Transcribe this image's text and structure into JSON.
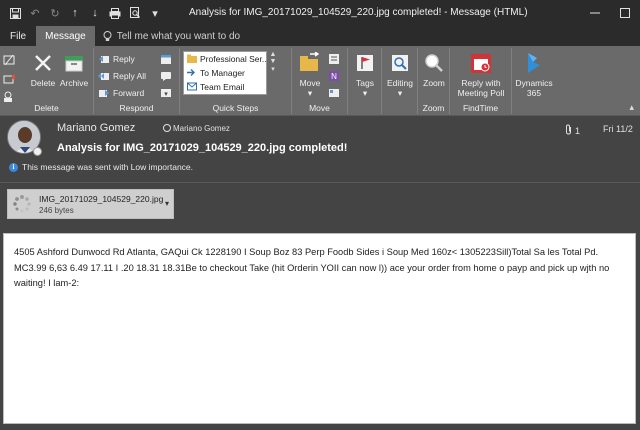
{
  "window": {
    "title": "Analysis for IMG_20171029_104529_220.jpg completed!  -  Message (HTML)"
  },
  "tabs": [
    {
      "label": "File"
    },
    {
      "label": "Message"
    }
  ],
  "tell_me": {
    "placeholder": "Tell me what you want to do"
  },
  "ribbon": {
    "delete_group": {
      "label": "Delete",
      "delete": "Delete",
      "archive": "Archive"
    },
    "respond_group": {
      "label": "Respond",
      "reply": "Reply",
      "reply_all": "Reply All",
      "forward": "Forward"
    },
    "quick_steps": {
      "label": "Quick Steps",
      "items": [
        "Professional Ser...",
        "To Manager",
        "Team Email"
      ]
    },
    "move_group": {
      "label": "Move",
      "move": "Move"
    },
    "tags": {
      "label": "Tags"
    },
    "editing": {
      "label": "Editing"
    },
    "zoom_group": {
      "label": "Zoom",
      "zoom": "Zoom"
    },
    "findtime": {
      "label": "FindTime",
      "button": "Reply with Meeting Poll"
    },
    "dynamics": {
      "label": "Dynamics 365"
    }
  },
  "message": {
    "sender": "Mariano Gomez",
    "sender_small": "Mariano Gomez",
    "subject": "Analysis for IMG_20171029_104529_220.jpg completed!",
    "attachment_count": "1",
    "date": "Fri 11/2",
    "importance_notice": "This message was sent with Low importance.",
    "attachment": {
      "name": "IMG_20171029_104529_220.jpg",
      "size": "246 bytes"
    },
    "body": "4505 Ashford Dunwocd Rd Atlanta, GAQui Ck 1228190 I Soup Boz 83 Perp Foodb Sides i Soup Med 160z< 1305223Sill)Total Sa les Total Pd. MC3.99 6,63 6.49 17.11 I .20 18.31 18.31Be to checkout Take (hit Orderin YOII can now l)) ace your order from home o payp and pick up wjth no waiting! I lam-2:"
  },
  "colors": {
    "titlebar": "#2b2b2b",
    "ribbon": "#6a6a6a",
    "header_bg": "#444444",
    "info_blue": "#3b8ad9",
    "findtime_red": "#d13438",
    "dynamics_blue": "#2f8fd8"
  }
}
